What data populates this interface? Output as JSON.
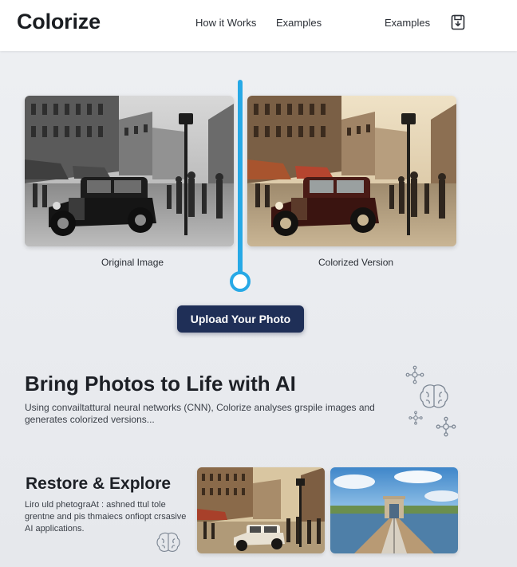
{
  "header": {
    "logo": "Colorize",
    "nav": [
      "How it Works",
      "Examples",
      "Examples"
    ],
    "icon": "save-icon"
  },
  "comparison": {
    "original_caption": "Original Image",
    "colorized_caption": "Colorized Version",
    "slider_color": "#27a9e6"
  },
  "upload": {
    "label": "Upload Your Photo",
    "color": "#1f2f57"
  },
  "intro": {
    "title": "Bring Photos to Life with AI",
    "body": "Using convailtattural neural networks (CNN), Colorize analyses grspile images and generates colorized versions..."
  },
  "restore": {
    "title": "Restore & Explore",
    "body": "Liro uld phetograAt : ashned ttul tole grentne and pis thmaiecs onfiopt crsasive AI applications."
  },
  "icons": [
    "network-icon",
    "brain-icon",
    "network-icon",
    "network-icon",
    "brain-icon"
  ]
}
